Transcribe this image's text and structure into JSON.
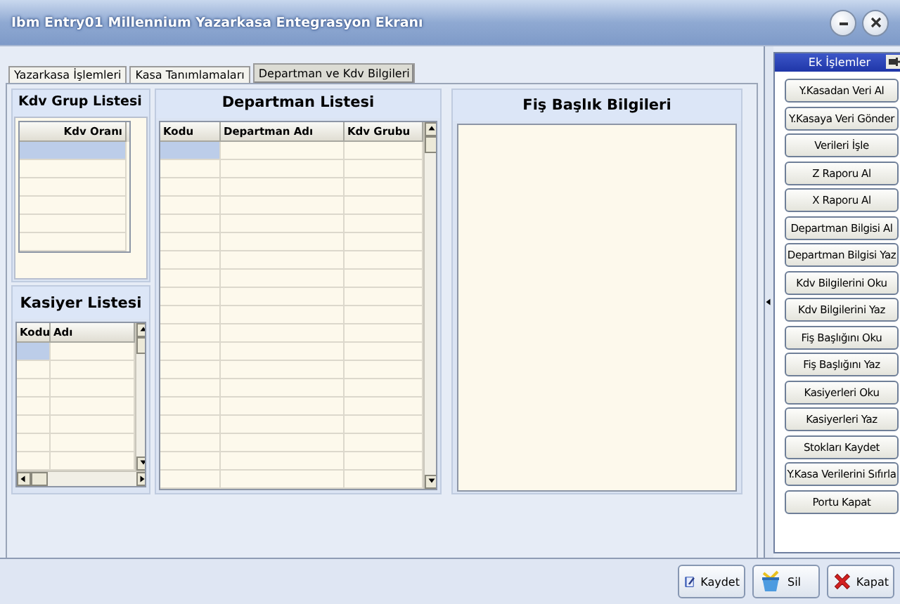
{
  "window": {
    "title": "Ibm Entry01 Millennium Yazarkasa Entegrasyon Ekranı"
  },
  "tabs": [
    {
      "label": "Yazarkasa İşlemleri",
      "selected": false
    },
    {
      "label": "Kasa Tanımlamaları",
      "selected": false
    },
    {
      "label": "Departman ve Kdv Bilgileri",
      "selected": true
    }
  ],
  "kdv_group_list": {
    "title": "Kdv Grup Listesi",
    "columns": [
      "Kdv Oranı"
    ],
    "rows": [
      {
        "selected": true
      },
      {
        "selected": false
      },
      {
        "selected": false
      },
      {
        "selected": false
      },
      {
        "selected": false
      },
      {
        "selected": false
      }
    ]
  },
  "cashier_list": {
    "title": "Kasiyer Listesi",
    "columns": [
      "Kodu",
      "Adı"
    ],
    "rows": [
      {
        "selected": true
      },
      {
        "selected": false
      },
      {
        "selected": false
      },
      {
        "selected": false
      },
      {
        "selected": false
      },
      {
        "selected": false
      },
      {
        "selected": false
      }
    ]
  },
  "department_list": {
    "title": "Departman Listesi",
    "columns": [
      "Kodu",
      "Departman Adı",
      "Kdv Grubu"
    ],
    "rows": [
      {
        "selected": true
      },
      {
        "selected": false
      },
      {
        "selected": false
      },
      {
        "selected": false
      },
      {
        "selected": false
      },
      {
        "selected": false
      },
      {
        "selected": false
      },
      {
        "selected": false
      },
      {
        "selected": false
      },
      {
        "selected": false
      },
      {
        "selected": false
      },
      {
        "selected": false
      },
      {
        "selected": false
      },
      {
        "selected": false
      },
      {
        "selected": false
      },
      {
        "selected": false
      },
      {
        "selected": false
      },
      {
        "selected": false
      },
      {
        "selected": false
      }
    ]
  },
  "receipt_header": {
    "title": "Fiş Başlık Bilgileri"
  },
  "sidebar": {
    "title": "Ek İşlemler",
    "buttons": [
      "Y.Kasadan Veri Al",
      "Y.Kasaya Veri Gönder",
      "Verileri İşle",
      "Z Raporu Al",
      "X Raporu Al",
      "Departman Bilgisi Al",
      "Departman Bilgisi Yaz",
      "Kdv Bilgilerini Oku",
      "Kdv Bilgilerini Yaz",
      "Fiş Başlığını Oku",
      "Fiş Başlığını Yaz",
      "Kasiyerleri Oku",
      "Kasiyerleri Yaz",
      "Stokları Kaydet",
      "Y.Kasa Verilerini Sıfırla",
      "Portu Kapat"
    ]
  },
  "footer_buttons": [
    {
      "label": "Kaydet",
      "kind": "save"
    },
    {
      "label": "Sil",
      "kind": "delete"
    },
    {
      "label": "Kapat",
      "kind": "close"
    }
  ]
}
